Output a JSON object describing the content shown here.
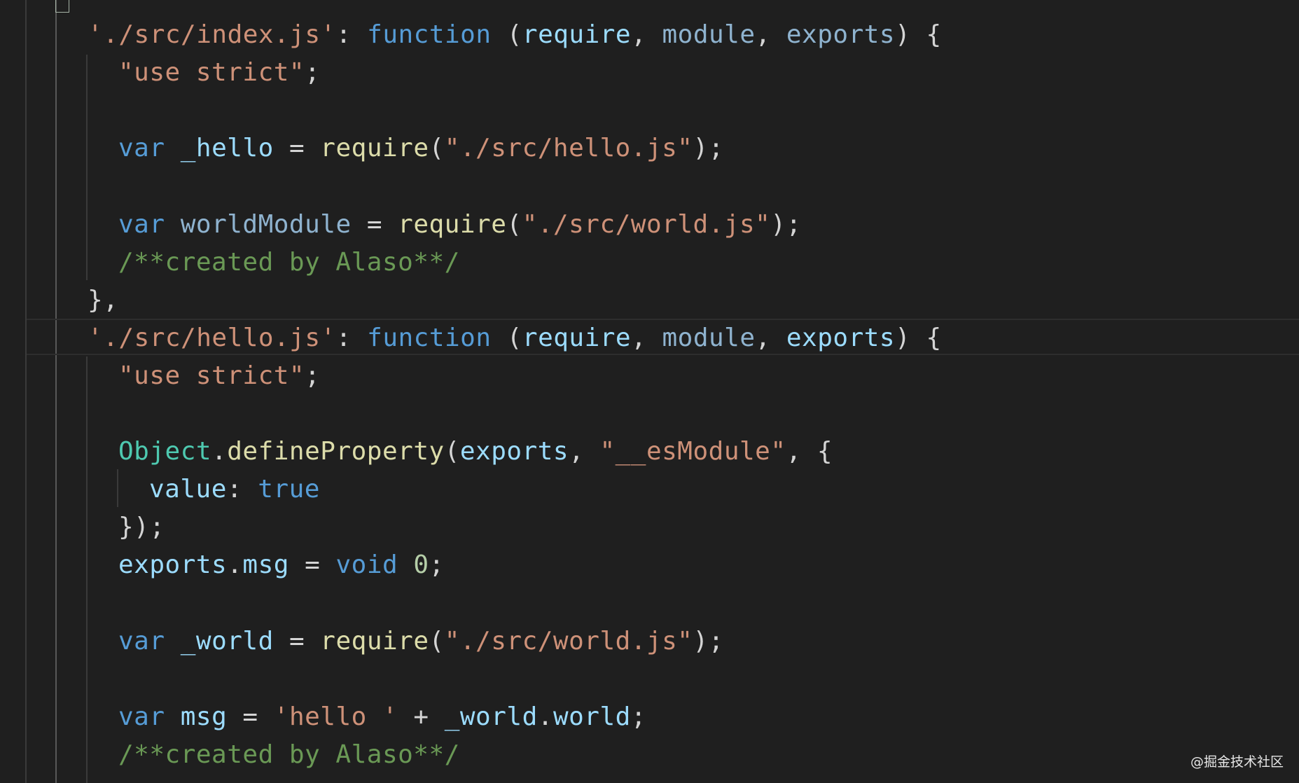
{
  "editor": {
    "lines": [
      {
        "indent": 0,
        "tokens": [
          {
            "t": "'./src/index.js'",
            "c": "t-str"
          },
          {
            "t": ": ",
            "c": "t-punc"
          },
          {
            "t": "function",
            "c": "t-kw"
          },
          {
            "t": " (",
            "c": "t-punc"
          },
          {
            "t": "require",
            "c": "t-var"
          },
          {
            "t": ", ",
            "c": "t-punc"
          },
          {
            "t": "module",
            "c": "t-dim"
          },
          {
            "t": ", ",
            "c": "t-punc"
          },
          {
            "t": "exports",
            "c": "t-dim"
          },
          {
            "t": ") {",
            "c": "t-punc"
          }
        ]
      },
      {
        "indent": 1,
        "tokens": [
          {
            "t": "\"use strict\"",
            "c": "t-str"
          },
          {
            "t": ";",
            "c": "t-punc"
          }
        ]
      },
      {
        "indent": 0,
        "tokens": []
      },
      {
        "indent": 1,
        "tokens": [
          {
            "t": "var",
            "c": "t-kw"
          },
          {
            "t": " ",
            "c": "t-punc"
          },
          {
            "t": "_hello",
            "c": "t-var"
          },
          {
            "t": " = ",
            "c": "t-punc"
          },
          {
            "t": "require",
            "c": "t-fn"
          },
          {
            "t": "(",
            "c": "t-punc"
          },
          {
            "t": "\"./src/hello.js\"",
            "c": "t-str"
          },
          {
            "t": ");",
            "c": "t-punc"
          }
        ]
      },
      {
        "indent": 0,
        "tokens": []
      },
      {
        "indent": 1,
        "tokens": [
          {
            "t": "var",
            "c": "t-kw"
          },
          {
            "t": " ",
            "c": "t-punc"
          },
          {
            "t": "worldModule",
            "c": "t-dim"
          },
          {
            "t": " = ",
            "c": "t-punc"
          },
          {
            "t": "require",
            "c": "t-fn"
          },
          {
            "t": "(",
            "c": "t-punc"
          },
          {
            "t": "\"./src/world.js\"",
            "c": "t-str"
          },
          {
            "t": ");",
            "c": "t-punc"
          }
        ]
      },
      {
        "indent": 1,
        "tokens": [
          {
            "t": "/**created by Alaso**/",
            "c": "t-cmt"
          }
        ]
      },
      {
        "indent": 0,
        "tokens": [
          {
            "t": "},",
            "c": "t-punc"
          }
        ]
      },
      {
        "indent": 0,
        "tokens": [
          {
            "t": "'./src/hello.js'",
            "c": "t-str"
          },
          {
            "t": ": ",
            "c": "t-punc"
          },
          {
            "t": "function",
            "c": "t-kw"
          },
          {
            "t": " (",
            "c": "t-punc"
          },
          {
            "t": "require",
            "c": "t-var"
          },
          {
            "t": ", ",
            "c": "t-punc"
          },
          {
            "t": "module",
            "c": "t-dim"
          },
          {
            "t": ", ",
            "c": "t-punc"
          },
          {
            "t": "exports",
            "c": "t-var"
          },
          {
            "t": ") {",
            "c": "t-punc"
          }
        ]
      },
      {
        "indent": 1,
        "tokens": [
          {
            "t": "\"use strict\"",
            "c": "t-str"
          },
          {
            "t": ";",
            "c": "t-punc"
          }
        ]
      },
      {
        "indent": 0,
        "tokens": []
      },
      {
        "indent": 1,
        "tokens": [
          {
            "t": "Object",
            "c": "t-cls"
          },
          {
            "t": ".",
            "c": "t-punc"
          },
          {
            "t": "defineProperty",
            "c": "t-fn"
          },
          {
            "t": "(",
            "c": "t-punc"
          },
          {
            "t": "exports",
            "c": "t-var"
          },
          {
            "t": ", ",
            "c": "t-punc"
          },
          {
            "t": "\"__esModule\"",
            "c": "t-str"
          },
          {
            "t": ", {",
            "c": "t-punc"
          }
        ]
      },
      {
        "indent": 2,
        "tokens": [
          {
            "t": "value",
            "c": "t-var"
          },
          {
            "t": ": ",
            "c": "t-punc"
          },
          {
            "t": "true",
            "c": "t-kw"
          }
        ]
      },
      {
        "indent": 1,
        "tokens": [
          {
            "t": "});",
            "c": "t-punc"
          }
        ]
      },
      {
        "indent": 1,
        "tokens": [
          {
            "t": "exports",
            "c": "t-var"
          },
          {
            "t": ".",
            "c": "t-punc"
          },
          {
            "t": "msg",
            "c": "t-var"
          },
          {
            "t": " = ",
            "c": "t-punc"
          },
          {
            "t": "void",
            "c": "t-kw"
          },
          {
            "t": " ",
            "c": "t-punc"
          },
          {
            "t": "0",
            "c": "t-num"
          },
          {
            "t": ";",
            "c": "t-punc"
          }
        ]
      },
      {
        "indent": 0,
        "tokens": []
      },
      {
        "indent": 1,
        "tokens": [
          {
            "t": "var",
            "c": "t-kw"
          },
          {
            "t": " ",
            "c": "t-punc"
          },
          {
            "t": "_world",
            "c": "t-var"
          },
          {
            "t": " = ",
            "c": "t-punc"
          },
          {
            "t": "require",
            "c": "t-fn"
          },
          {
            "t": "(",
            "c": "t-punc"
          },
          {
            "t": "\"./src/world.js\"",
            "c": "t-str"
          },
          {
            "t": ");",
            "c": "t-punc"
          }
        ]
      },
      {
        "indent": 0,
        "tokens": []
      },
      {
        "indent": 1,
        "tokens": [
          {
            "t": "var",
            "c": "t-kw"
          },
          {
            "t": " ",
            "c": "t-punc"
          },
          {
            "t": "msg",
            "c": "t-var"
          },
          {
            "t": " = ",
            "c": "t-punc"
          },
          {
            "t": "'hello '",
            "c": "t-str"
          },
          {
            "t": " + ",
            "c": "t-punc"
          },
          {
            "t": "_world",
            "c": "t-var"
          },
          {
            "t": ".",
            "c": "t-punc"
          },
          {
            "t": "world",
            "c": "t-var"
          },
          {
            "t": ";",
            "c": "t-punc"
          }
        ]
      },
      {
        "indent": 1,
        "tokens": [
          {
            "t": "/**created by Alaso**/",
            "c": "t-cmt"
          }
        ]
      }
    ]
  },
  "watermark": "@掘金技术社区"
}
